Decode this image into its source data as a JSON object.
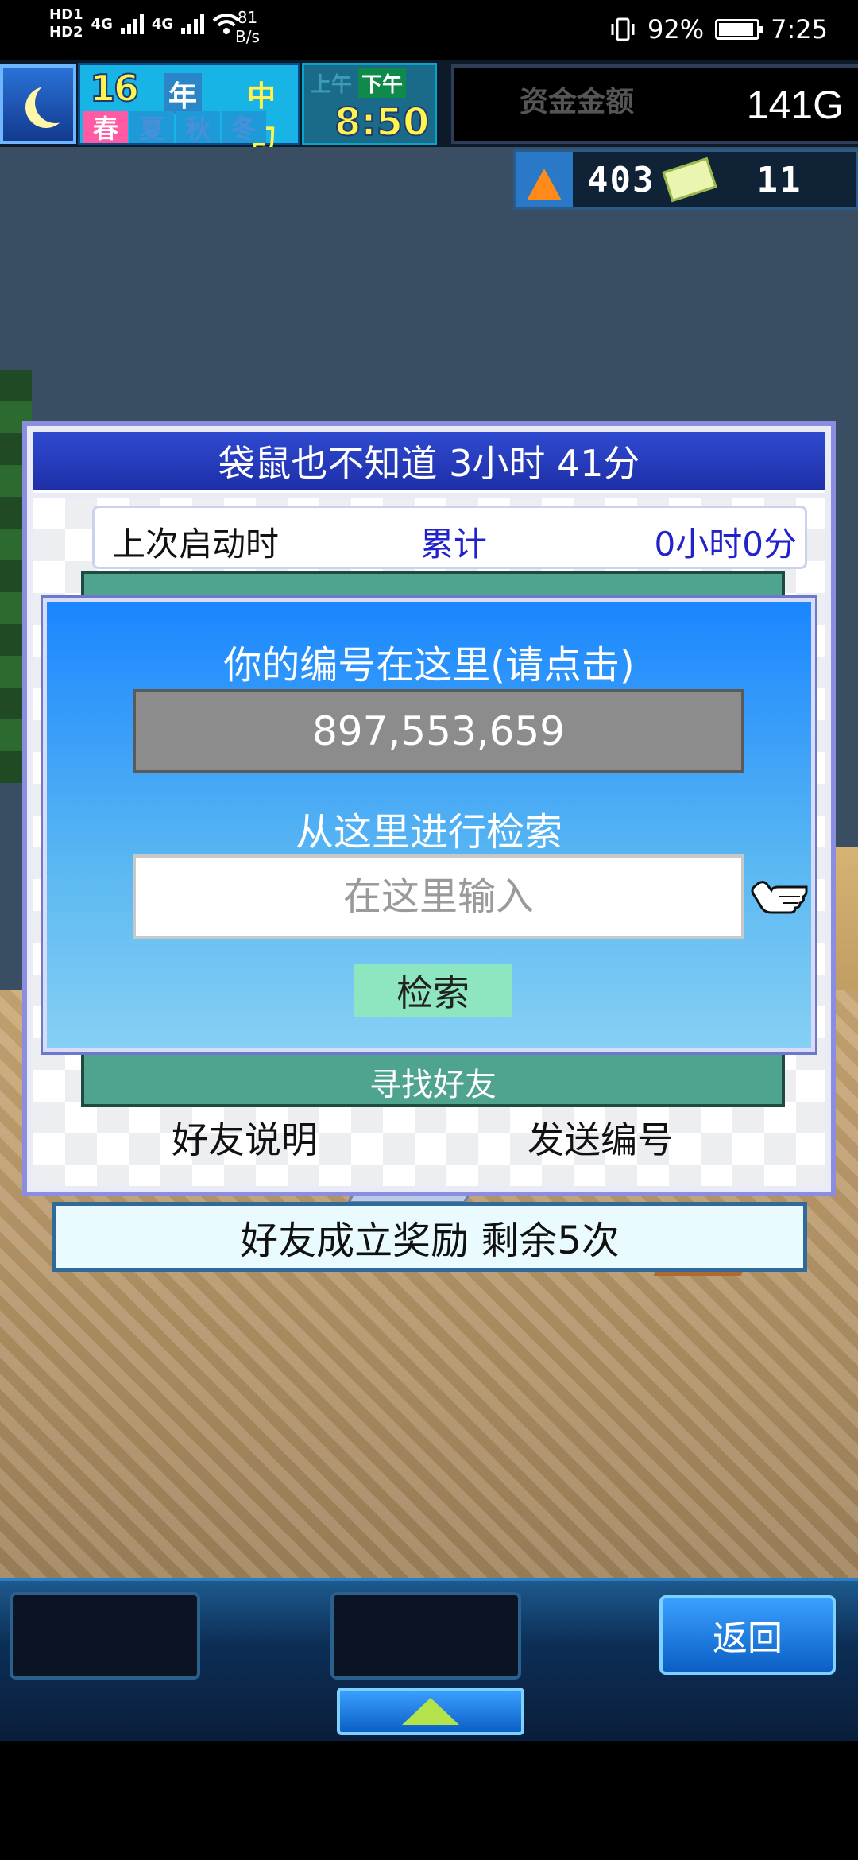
{
  "status_bar": {
    "network_left": "HD",
    "network_sub": "1",
    "network_left2": "HD",
    "network_sub2": "2",
    "gen1": "4G",
    "gen2": "4G",
    "speed_value": "81",
    "speed_unit": "B/s",
    "battery_percent": "92%",
    "time": "7:25"
  },
  "hud": {
    "year": "16",
    "year_unit": "年",
    "period": "中旬",
    "seasons": [
      "春",
      "夏",
      "秋",
      "冬"
    ],
    "active_season": 0,
    "am_label": "上午",
    "pm_label": "下午",
    "clock": "8:50",
    "money_label": "资金金额",
    "money": "141G",
    "research_points": "403",
    "tickets": "11"
  },
  "panel": {
    "title": "袋鼠也不知道  3小时 41分",
    "last_start_label": "上次启动时",
    "total_label": "累计",
    "total_value": "0小时0分",
    "find_friends": "寻找好友",
    "friend_explain": "好友说明",
    "send_number": "发送编号"
  },
  "dialog": {
    "title": "你的编号在这里(请点击)",
    "user_id": "897,553,659",
    "search_label": "从这里进行检索",
    "search_placeholder": "在这里输入",
    "search_button": "检索"
  },
  "reward": {
    "text": "好友成立奖励  剩余5次"
  },
  "bottom": {
    "back_label": "返回"
  }
}
